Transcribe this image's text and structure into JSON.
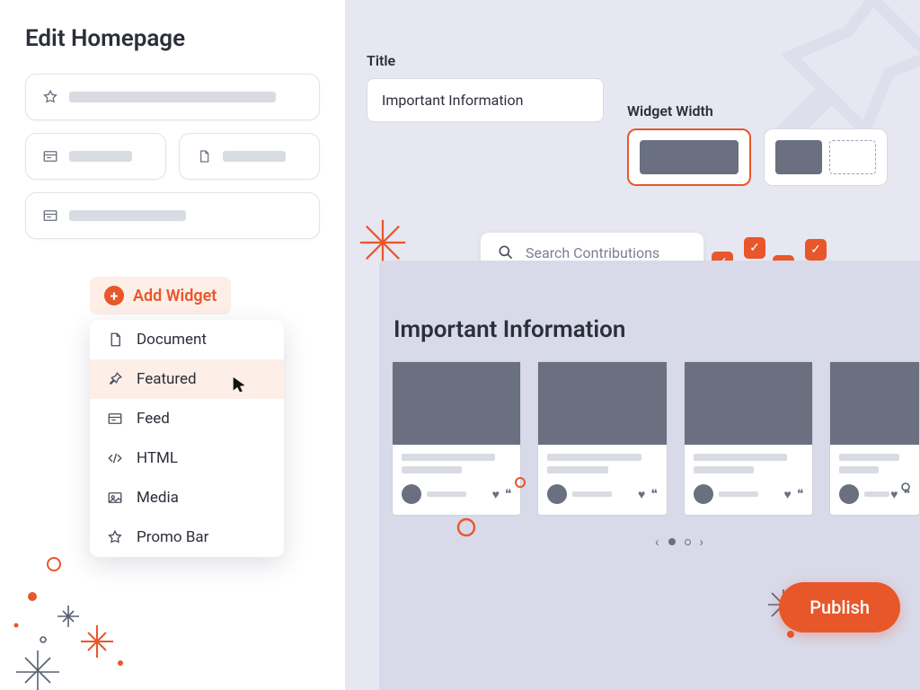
{
  "left": {
    "heading": "Edit Homepage",
    "add_widget_label": "Add Widget",
    "menu": {
      "document": "Document",
      "featured": "Featured",
      "feed": "Feed",
      "html": "HTML",
      "media": "Media",
      "promo_bar": "Promo Bar"
    }
  },
  "right": {
    "title_label": "Title",
    "title_value": "Important Information",
    "width_label": "Widget Width",
    "search_placeholder": "Search Contributions",
    "preview_heading": "Important Information",
    "publish_label": "Publish"
  },
  "colors": {
    "accent": "#e8572a",
    "panel": "#e6e7f1"
  }
}
